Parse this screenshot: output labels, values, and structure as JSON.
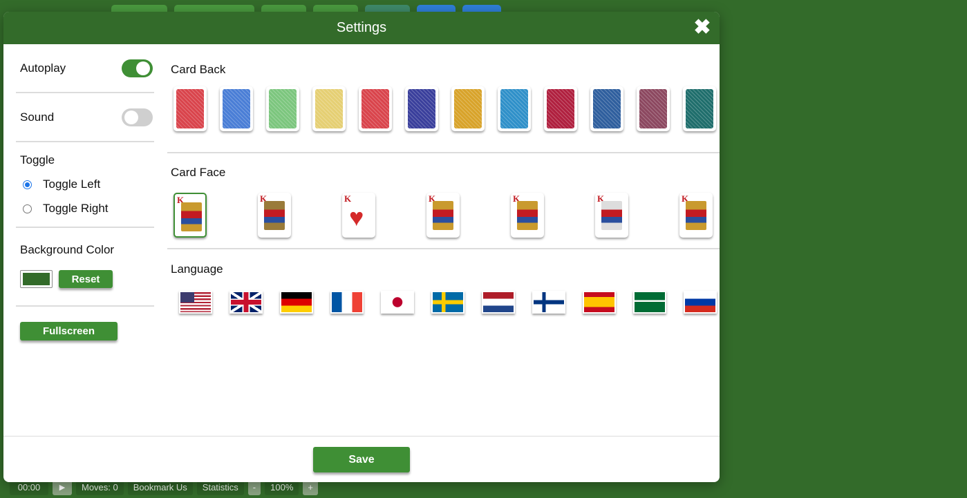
{
  "dialog": {
    "title": "Settings",
    "close_symbol": "✖"
  },
  "settings": {
    "autoplay": {
      "label": "Autoplay",
      "on": true
    },
    "sound": {
      "label": "Sound",
      "on": false
    },
    "toggle": {
      "title": "Toggle",
      "options": [
        {
          "label": "Toggle Left",
          "selected": true
        },
        {
          "label": "Toggle Right",
          "selected": false
        }
      ]
    },
    "background": {
      "title": "Background Color",
      "color": "#336b2a",
      "reset_label": "Reset"
    },
    "fullscreen_label": "Fullscreen"
  },
  "card_back": {
    "title": "Card Back",
    "colors": [
      "#d9444c",
      "#4a7ed6",
      "#7cc67e",
      "#e5cf73",
      "#d9444c",
      "#3a3f9c",
      "#d8a32a",
      "#2f90c9",
      "#b0203f",
      "#2f5f9e",
      "#8c4860",
      "#1f6e6c"
    ]
  },
  "card_face": {
    "title": "Card Face",
    "rank_label": "K",
    "styles": [
      "classic-1",
      "classic-2",
      "big-heart",
      "queen-style",
      "minimal",
      "portrait",
      "large-index"
    ],
    "selected_index": 0
  },
  "language": {
    "title": "Language",
    "flags": [
      "us",
      "uk",
      "de",
      "fr",
      "jp",
      "se",
      "nl",
      "fi",
      "es",
      "sa",
      "ru"
    ]
  },
  "footer": {
    "save_label": "Save"
  },
  "status_bar": {
    "time": "00:00",
    "play_symbol": "▶",
    "moves": "Moves: 0",
    "bookmark": "Bookmark Us",
    "statistics": "Statistics",
    "zoom_out": "-",
    "zoom": "100%",
    "zoom_in": "+"
  }
}
